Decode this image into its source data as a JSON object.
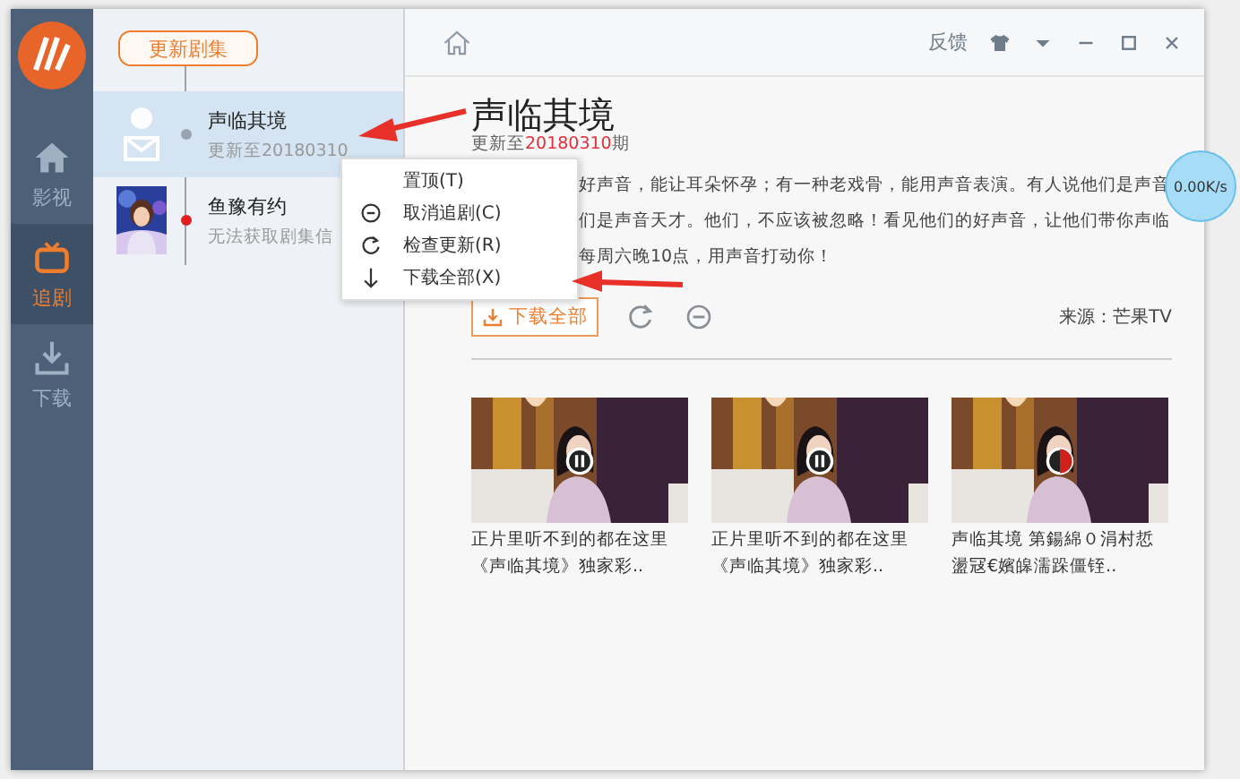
{
  "titlebar": {
    "feedback": "反馈"
  },
  "nav": {
    "items": [
      {
        "label": "影视",
        "selected": false
      },
      {
        "label": "追剧",
        "selected": true
      },
      {
        "label": "下载",
        "selected": false
      }
    ]
  },
  "series_panel": {
    "update_button": "更新剧集",
    "items": [
      {
        "title": "声临其境",
        "subtitle": "更新至20180310",
        "selected": true,
        "color": "#9aa4ae"
      },
      {
        "title": "鱼豫有约",
        "subtitle": "无法获取剧集信",
        "selected": false,
        "color": "#e02020"
      }
    ]
  },
  "context_menu": {
    "items": [
      {
        "label": "置顶(T)"
      },
      {
        "label": "取消追剧(C)"
      },
      {
        "label": "检查更新(R)"
      },
      {
        "label": "下载全部(X)"
      }
    ]
  },
  "detail": {
    "title": "声临其境",
    "update_prefix": "更新至",
    "update_date": "20180310",
    "update_suffix": "期",
    "description_lines": [
      "好声音，能让耳朵怀孕；有一种老戏骨，能用声音表演。有人说他们是声音",
      "们是声音天才。他们，不应该被忽略！看见他们的好声音，让他们带你声临",
      "每周六晚10点，用声音打动你！"
    ],
    "download_button": "下载全部",
    "source": "来源：芒果TV",
    "videos": [
      {
        "caption": "正片里听不到的都在这里《声临其境》独家彩.."
      },
      {
        "caption": "正片里听不到的都在这里《声临其境》独家彩.."
      },
      {
        "caption": "声临其境 第鍚綿０涓村悊盪冦€嬪皞濡跺僵铚.."
      }
    ]
  },
  "speed": "0.00K/s"
}
